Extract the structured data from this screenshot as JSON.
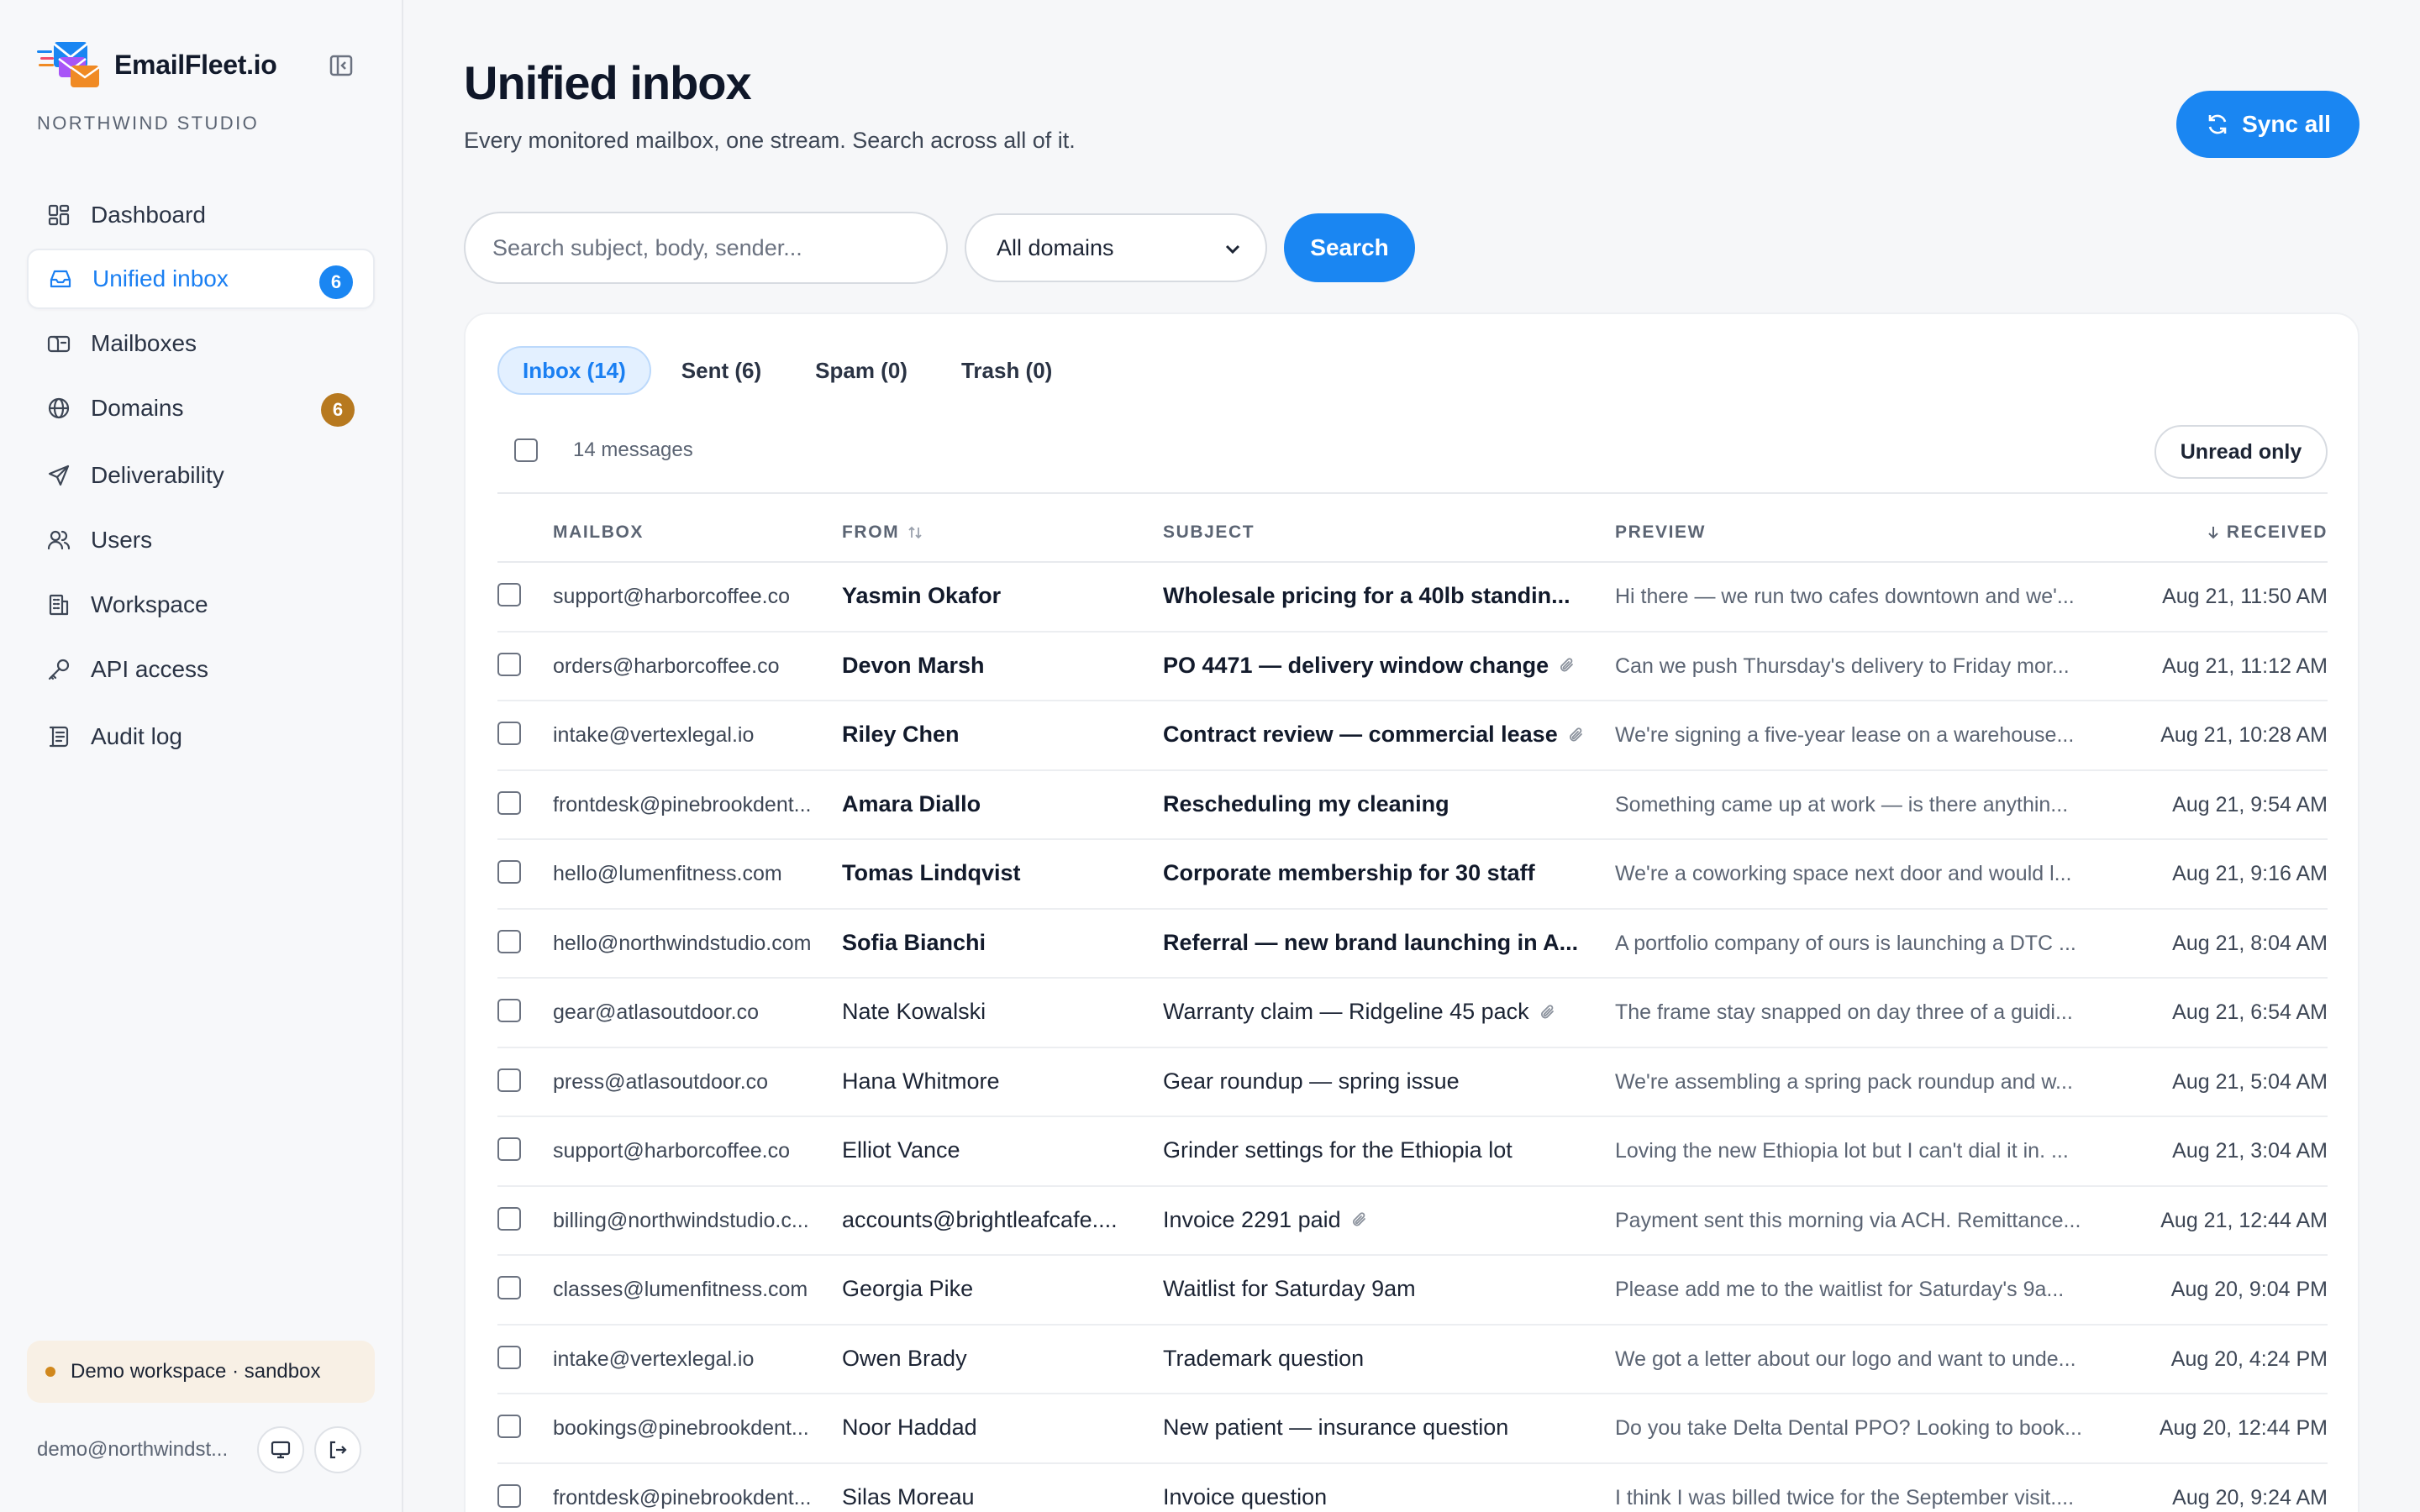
{
  "brand": {
    "name": "EmailFleet.io",
    "org": "NORTHWIND STUDIO"
  },
  "nav": [
    {
      "label": "Dashboard",
      "icon": "dashboard-grid-icon",
      "active": false
    },
    {
      "label": "Unified inbox",
      "icon": "inbox-icon",
      "active": true,
      "badge": "6",
      "badge_color": "#1a86f2"
    },
    {
      "label": "Mailboxes",
      "icon": "mailbox-icon",
      "active": false
    },
    {
      "label": "Domains",
      "icon": "globe-icon",
      "active": false,
      "badge": "6",
      "badge_color": "#b7791f"
    },
    {
      "label": "Deliverability",
      "icon": "send-icon",
      "active": false
    },
    {
      "label": "Users",
      "icon": "users-icon",
      "active": false
    },
    {
      "label": "Workspace",
      "icon": "building-icon",
      "active": false
    },
    {
      "label": "API access",
      "icon": "key-icon",
      "active": false
    },
    {
      "label": "Audit log",
      "icon": "audit-log-icon",
      "active": false
    }
  ],
  "demo": {
    "label": "Demo workspace · sandbox"
  },
  "user": {
    "email": "demo@northwindst..."
  },
  "header": {
    "title": "Unified inbox",
    "subtitle": "Every monitored mailbox, one stream. Search across all of it.",
    "sync_label": "Sync all"
  },
  "search": {
    "placeholder": "Search subject, body, sender...",
    "domain_selected": "All domains",
    "button": "Search"
  },
  "tabs": [
    {
      "label": "Inbox (14)",
      "active": true
    },
    {
      "label": "Sent (6)",
      "active": false
    },
    {
      "label": "Spam (0)",
      "active": false
    },
    {
      "label": "Trash (0)",
      "active": false
    }
  ],
  "toolbar": {
    "count": "14 messages",
    "unread_only": "Unread only"
  },
  "columns": {
    "mailbox": "MAILBOX",
    "from": "FROM",
    "subject": "SUBJECT",
    "preview": "PREVIEW",
    "received": "RECEIVED"
  },
  "messages": [
    {
      "mailbox": "support@harborcoffee.co",
      "from": "Yasmin Okafor",
      "subject": "Wholesale pricing for a 40lb standin...",
      "attach": false,
      "preview": "Hi there — we run two cafes downtown and we'...",
      "received": "Aug 21, 11:50 AM",
      "unread": true
    },
    {
      "mailbox": "orders@harborcoffee.co",
      "from": "Devon Marsh",
      "subject": "PO 4471 — delivery window change",
      "attach": true,
      "preview": "Can we push Thursday's delivery to Friday mor...",
      "received": "Aug 21, 11:12 AM",
      "unread": true
    },
    {
      "mailbox": "intake@vertexlegal.io",
      "from": "Riley Chen",
      "subject": "Contract review — commercial lease",
      "attach": true,
      "preview": "We're signing a five-year lease on a warehouse...",
      "received": "Aug 21, 10:28 AM",
      "unread": true
    },
    {
      "mailbox": "frontdesk@pinebrookdent...",
      "from": "Amara Diallo",
      "subject": "Rescheduling my cleaning",
      "attach": false,
      "preview": "Something came up at work — is there anythin...",
      "received": "Aug 21, 9:54 AM",
      "unread": true
    },
    {
      "mailbox": "hello@lumenfitness.com",
      "from": "Tomas Lindqvist",
      "subject": "Corporate membership for 30 staff",
      "attach": false,
      "preview": "We're a coworking space next door and would l...",
      "received": "Aug 21, 9:16 AM",
      "unread": true
    },
    {
      "mailbox": "hello@northwindstudio.com",
      "from": "Sofia Bianchi",
      "subject": "Referral — new brand launching in A...",
      "attach": false,
      "preview": "A portfolio company of ours is launching a DTC ...",
      "received": "Aug 21, 8:04 AM",
      "unread": true
    },
    {
      "mailbox": "gear@atlasoutdoor.co",
      "from": "Nate Kowalski",
      "subject": "Warranty claim — Ridgeline 45 pack",
      "attach": true,
      "preview": "The frame stay snapped on day three of a guidi...",
      "received": "Aug 21, 6:54 AM",
      "unread": false
    },
    {
      "mailbox": "press@atlasoutdoor.co",
      "from": "Hana Whitmore",
      "subject": "Gear roundup — spring issue",
      "attach": false,
      "preview": "We're assembling a spring pack roundup and w...",
      "received": "Aug 21, 5:04 AM",
      "unread": false
    },
    {
      "mailbox": "support@harborcoffee.co",
      "from": "Elliot Vance",
      "subject": "Grinder settings for the Ethiopia lot",
      "attach": false,
      "preview": "Loving the new Ethiopia lot but I can't dial it in. ...",
      "received": "Aug 21, 3:04 AM",
      "unread": false
    },
    {
      "mailbox": "billing@northwindstudio.c...",
      "from": "accounts@brightleafcafe....",
      "subject": "Invoice 2291 paid",
      "attach": true,
      "preview": "Payment sent this morning via ACH. Remittance...",
      "received": "Aug 21, 12:44 AM",
      "unread": false
    },
    {
      "mailbox": "classes@lumenfitness.com",
      "from": "Georgia Pike",
      "subject": "Waitlist for Saturday 9am",
      "attach": false,
      "preview": "Please add me to the waitlist for Saturday's 9a...",
      "received": "Aug 20, 9:04 PM",
      "unread": false
    },
    {
      "mailbox": "intake@vertexlegal.io",
      "from": "Owen Brady",
      "subject": "Trademark question",
      "attach": false,
      "preview": "We got a letter about our logo and want to unde...",
      "received": "Aug 20, 4:24 PM",
      "unread": false
    },
    {
      "mailbox": "bookings@pinebrookdent...",
      "from": "Noor Haddad",
      "subject": "New patient — insurance question",
      "attach": false,
      "preview": "Do you take Delta Dental PPO? Looking to book...",
      "received": "Aug 20, 12:44 PM",
      "unread": false
    },
    {
      "mailbox": "frontdesk@pinebrookdent...",
      "from": "Silas Moreau",
      "subject": "Invoice question",
      "attach": false,
      "preview": "I think I was billed twice for the September visit....",
      "received": "Aug 20, 9:24 AM",
      "unread": false
    }
  ]
}
